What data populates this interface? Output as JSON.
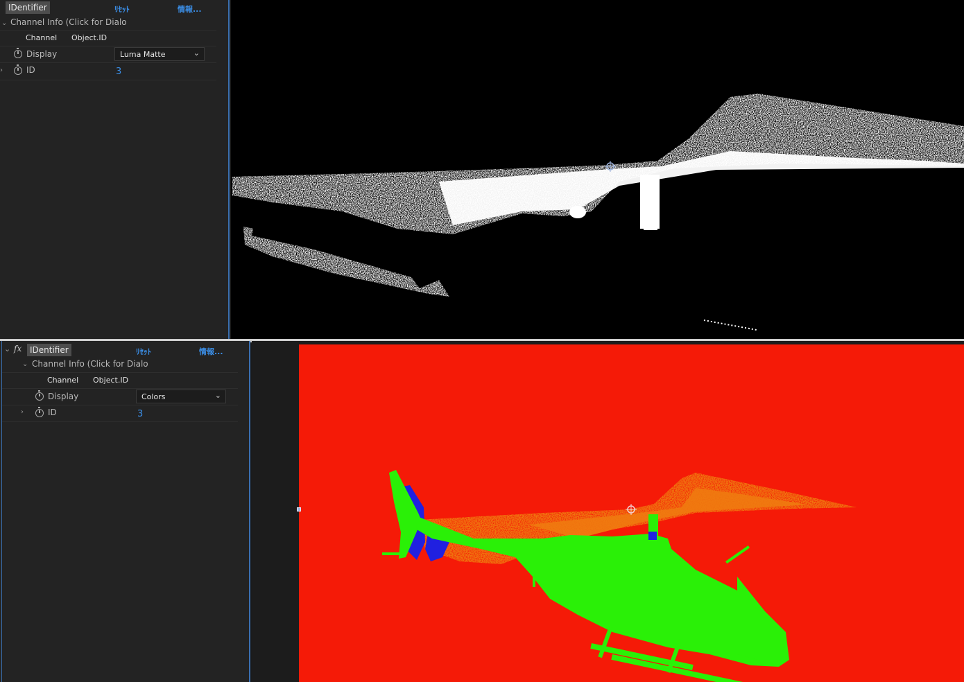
{
  "top_panel": {
    "effect_name": "IDentifier",
    "reset_label": "ﾘｾｯﾄ",
    "info_label": "情報...",
    "group_label": "Channel Info (Click for Dialo",
    "column_channel": "Channel",
    "column_object_id": "Object.ID",
    "display_label": "Display",
    "display_value": "Luma Matte",
    "id_label": "ID",
    "id_value": "3"
  },
  "bottom_panel": {
    "fx_label": "fx",
    "effect_name": "IDentifier",
    "reset_label": "ﾘｾｯﾄ",
    "info_label": "情報...",
    "group_label": "Channel Info (Click for Dialo",
    "column_channel": "Channel",
    "column_object_id": "Object.ID",
    "display_label": "Display",
    "display_value": "Colors",
    "id_label": "ID",
    "id_value": "3"
  },
  "icons": {
    "stopwatch": "stopwatch-icon",
    "twirl_open": "chevron-down-icon",
    "twirl_closed": "chevron-right-icon",
    "dropdown": "chevron-down-icon",
    "anchor": "anchor-point-icon"
  },
  "colors": {
    "panel_bg": "#232323",
    "accent_blue": "#3b8ee6",
    "matte_white": "#ffffff",
    "matte_black": "#000000",
    "id_red": "#f51a07",
    "id_green": "#2af007",
    "id_orange": "#f07a10",
    "id_blue": "#2020e0"
  }
}
